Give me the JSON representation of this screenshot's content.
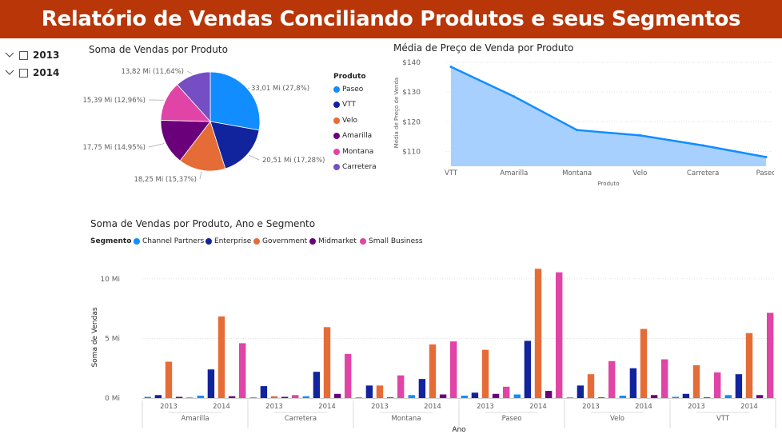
{
  "report": {
    "title": "Relatório de Vendas Conciliando Produtos e seus Segmentos"
  },
  "slicer": {
    "items": [
      {
        "label": "2013",
        "checked": false
      },
      {
        "label": "2014",
        "checked": false
      }
    ]
  },
  "colors": {
    "banner": "#b83608",
    "Paseo": "#118dff",
    "VTT": "#12239e",
    "Velo": "#e66c37",
    "Amarilla": "#6b007b",
    "Montana": "#e044a7",
    "Carretera": "#744ec2",
    "area_fill": "#a8d0ff",
    "area_line": "#118dff"
  },
  "chart_data": [
    {
      "type": "pie",
      "title": "Soma de Vendas por Produto",
      "legend_title": "Produto",
      "legend_position": "right",
      "slices": [
        {
          "name": "Paseo",
          "value": 33.01,
          "label": "33,01 Mi (27,8%)",
          "percent": 27.8
        },
        {
          "name": "VTT",
          "value": 20.51,
          "label": "20,51 Mi (17,28%)",
          "percent": 17.28
        },
        {
          "name": "Velo",
          "value": 18.25,
          "label": "18,25 Mi (15,37%)",
          "percent": 15.37
        },
        {
          "name": "Amarilla",
          "value": 17.75,
          "label": "17,75 Mi (14,95%)",
          "percent": 14.95
        },
        {
          "name": "Montana",
          "value": 15.39,
          "label": "15,39 Mi (12,96%)",
          "percent": 12.96
        },
        {
          "name": "Carretera",
          "value": 13.82,
          "label": "13,82 Mi (11,64%)",
          "percent": 11.64
        }
      ]
    },
    {
      "type": "area",
      "title": "Média de Preço de Venda por Produto",
      "xlabel": "Produto",
      "ylabel": "Média de Preço de Venda",
      "categories": [
        "VTT",
        "Amarilla",
        "Montana",
        "Velo",
        "Carretera",
        "Paseo"
      ],
      "values": [
        138.5,
        128.5,
        117.2,
        115.4,
        112.0,
        108.1
      ],
      "ylim": [
        105,
        140
      ],
      "yticks": [
        110,
        120,
        130,
        140
      ],
      "ytick_labels": [
        "$110",
        "$120",
        "$130",
        "$140"
      ],
      "grid": true
    },
    {
      "type": "bar",
      "title": "Soma de Vendas por Produto, Ano e Segmento",
      "legend_title": "Segmento",
      "legend_position": "top-left",
      "xlabel": "Ano",
      "ylabel": "Soma de Vendas",
      "ylim": [
        0,
        11
      ],
      "yticks": [
        0,
        5,
        10
      ],
      "ytick_labels": [
        "0 Mi",
        "5 Mi",
        "10 Mi"
      ],
      "grid": true,
      "groups": [
        {
          "product": "Amarilla",
          "years": [
            "2013",
            "2014"
          ]
        },
        {
          "product": "Carretera",
          "years": [
            "2013",
            "2014"
          ]
        },
        {
          "product": "Montana",
          "years": [
            "2013",
            "2014"
          ]
        },
        {
          "product": "Paseo",
          "years": [
            "2013",
            "2014"
          ]
        },
        {
          "product": "Velo",
          "years": [
            "2013",
            "2014"
          ]
        },
        {
          "product": "VTT",
          "years": [
            "2013",
            "2014"
          ]
        }
      ],
      "series": [
        {
          "name": "Channel Partners",
          "color": "#118dff",
          "values": [
            0.1,
            0.2,
            0.05,
            0.15,
            0.05,
            0.25,
            0.2,
            0.3,
            0.05,
            0.2,
            0.1,
            0.25
          ]
        },
        {
          "name": "Enterprise",
          "color": "#12239e",
          "values": [
            0.25,
            2.4,
            1.0,
            2.2,
            1.05,
            1.6,
            0.45,
            4.8,
            1.05,
            2.5,
            0.35,
            2.0
          ]
        },
        {
          "name": "Government",
          "color": "#e66c37",
          "values": [
            3.05,
            6.85,
            0.15,
            5.95,
            1.05,
            4.5,
            4.05,
            10.85,
            2.0,
            5.8,
            2.75,
            5.45
          ]
        },
        {
          "name": "Midmarket",
          "color": "#6b007b",
          "values": [
            0.1,
            0.15,
            0.1,
            0.35,
            0.05,
            0.3,
            0.35,
            0.6,
            0.05,
            0.25,
            0.05,
            0.25
          ]
        },
        {
          "name": "Small Business",
          "color": "#e044a7",
          "values": [
            0.05,
            4.6,
            0.25,
            3.7,
            1.9,
            4.75,
            0.95,
            10.55,
            3.1,
            3.25,
            2.15,
            7.15
          ]
        }
      ]
    }
  ]
}
